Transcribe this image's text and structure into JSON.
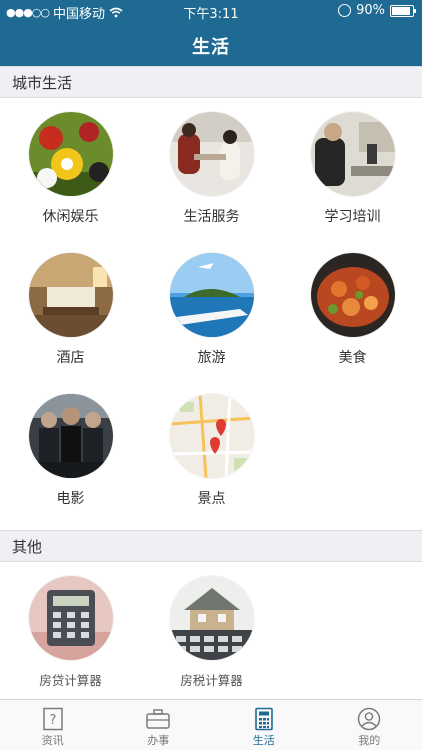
{
  "status_bar": {
    "carrier": "中国移动",
    "time": "下午3:11",
    "battery": "90%",
    "battery_level": 0.9
  },
  "header": {
    "title": "生活"
  },
  "sections": [
    {
      "title": "城市生活",
      "items": [
        {
          "label": "休闲娱乐",
          "icon": "billiards-image"
        },
        {
          "label": "生活服务",
          "icon": "service-image"
        },
        {
          "label": "学习培训",
          "icon": "training-image"
        },
        {
          "label": "酒店",
          "icon": "hotel-image"
        },
        {
          "label": "旅游",
          "icon": "travel-image"
        },
        {
          "label": "美食",
          "icon": "food-image"
        },
        {
          "label": "电影",
          "icon": "movie-image"
        },
        {
          "label": "景点",
          "icon": "map-image"
        }
      ]
    },
    {
      "title": "其他",
      "items": [
        {
          "label": "房贷计算器",
          "icon": "calculator-image"
        },
        {
          "label": "房税计算器",
          "icon": "house-tax-image"
        }
      ]
    }
  ],
  "tabbar": {
    "items": [
      {
        "label": "资讯",
        "icon": "question-doc-icon"
      },
      {
        "label": "办事",
        "icon": "briefcase-icon"
      },
      {
        "label": "生活",
        "icon": "calculator-icon",
        "active": true
      },
      {
        "label": "我的",
        "icon": "user-icon"
      }
    ]
  },
  "colors": {
    "primary": "#1f6a93",
    "section_bg": "#efeff4"
  }
}
